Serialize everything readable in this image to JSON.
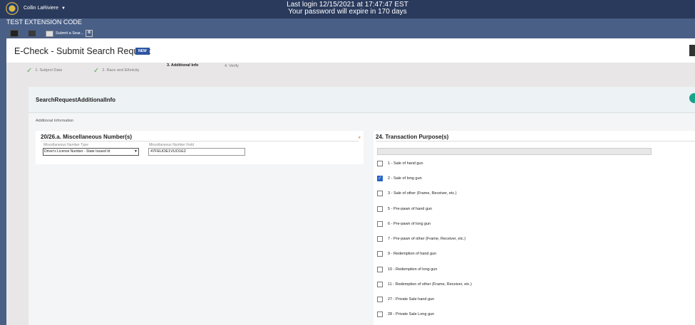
{
  "topbar": {
    "user_name": "Collin LaRiviere",
    "login_line1": "Last login 12/15/2021 at 17:47:47 EST",
    "login_line2": "Your password will expire in 170 days"
  },
  "extension_label": "TEST EXTENSION CODE",
  "tab": {
    "label": "Submit a Sear...",
    "close": "⊗"
  },
  "page": {
    "title": "E-Check - Submit Search Request",
    "badge": "NEW"
  },
  "steps": [
    {
      "label": "1. Subject Data",
      "done": true
    },
    {
      "label": "2. Race and Ethnicity",
      "done": true
    },
    {
      "label": "3. Additional Info",
      "active": true
    },
    {
      "label": "4. Verify"
    }
  ],
  "card": {
    "title": "SearchRequestAdditionalInfo",
    "section_label": "Additional Information",
    "misc": {
      "heading": "20/26.a. Miscellaneous Number(s)",
      "required_mark": "*",
      "type_label": "Miscellaneous Number Type",
      "type_value": "Driver's License Number - State Issued Id",
      "field_label": "Miscellaneous Number Field",
      "field_value": "47FEUOE1VUO1E2"
    },
    "purpose": {
      "heading": "24. Transaction Purpose(s)",
      "options": [
        {
          "label": "1 - Sale of hand gun",
          "checked": false
        },
        {
          "label": "2 - Sale of long gun",
          "checked": true
        },
        {
          "label": "3 - Sale of other (Frame, Receiver, etc.)",
          "checked": false
        },
        {
          "label": "5 - Pre-pawn of hand gun",
          "checked": false
        },
        {
          "label": "6 - Pre-pawn of long gun",
          "checked": false
        },
        {
          "label": "7 - Pre-pawn of other (Frame, Receiver, etc.)",
          "checked": false
        },
        {
          "label": "9 - Redemption of hand gun",
          "checked": false
        },
        {
          "label": "10 - Redemption of long gun",
          "checked": false
        },
        {
          "label": "11 - Redemption of other (Frame, Receiver, etc.)",
          "checked": false
        },
        {
          "label": "27 - Private Sale hand gun",
          "checked": false
        },
        {
          "label": "28 - Private Sale Long gun",
          "checked": false
        }
      ]
    }
  }
}
